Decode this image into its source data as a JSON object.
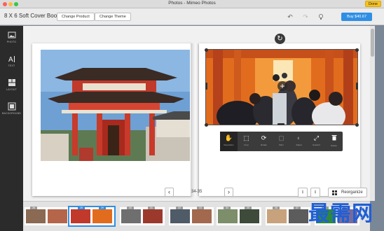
{
  "window": {
    "title": "Photos - Mimeo Photos",
    "done_label": "Done",
    "traffic_colors": [
      "#fc605c",
      "#fdbc40",
      "#34c84a"
    ]
  },
  "toolbar": {
    "book_title": "8 X 6 Soft Cover Book",
    "change_product_label": "Change Product",
    "change_theme_label": "Change Theme",
    "buy_label": "Buy $40.67",
    "accent_color": "#2f8fe4",
    "icons": [
      "undo-icon",
      "redo-icon",
      "lightbulb-icon"
    ]
  },
  "sidebar": {
    "items": [
      {
        "label": "PHOTO",
        "icon": "photo-icon"
      },
      {
        "label": "TEXT",
        "icon": "text-icon"
      },
      {
        "label": "LAYOUT",
        "icon": "layout-icon"
      },
      {
        "label": "BACKGROUND",
        "icon": "background-icon"
      }
    ]
  },
  "editor": {
    "left_photo": "red-pagoda-gate",
    "right_photo": "torii-tunnel-crowd",
    "edit_tools": [
      {
        "label": "Reposition",
        "icon": "hand-icon",
        "active": true
      },
      {
        "label": "Crop",
        "icon": "crop-icon",
        "active": false
      },
      {
        "label": "Rotate",
        "icon": "rotate-icon",
        "active": false
      },
      {
        "label": "Filter",
        "icon": "filter-icon",
        "active": false
      },
      {
        "label": "Adjust",
        "icon": "adjust-icon",
        "active": false
      },
      {
        "label": "Expand",
        "icon": "expand-icon",
        "active": false
      },
      {
        "label": "Delete",
        "icon": "trash-icon",
        "active": false
      }
    ]
  },
  "navigation": {
    "page_range": "34-35",
    "prev_icon": "chevron-left-icon",
    "next_icon": "chevron-right-icon",
    "reorganize_label": "Reorganize"
  },
  "filmstrip": {
    "spreads": [
      {
        "badge_left": "26",
        "badge_right": "27",
        "selected": false
      },
      {
        "badge_left": "28",
        "badge_right": "29",
        "selected": true
      },
      {
        "badge_left": "30",
        "badge_right": "31",
        "selected": false
      },
      {
        "badge_left": "32",
        "badge_right": "33",
        "selected": false
      },
      {
        "badge_left": "34",
        "badge_right": "35",
        "selected": false
      },
      {
        "badge_left": "36",
        "badge_right": "37",
        "selected": false
      },
      {
        "badge_left": "38",
        "badge_right": "39",
        "selected": false
      }
    ]
  },
  "watermark": "最需网"
}
